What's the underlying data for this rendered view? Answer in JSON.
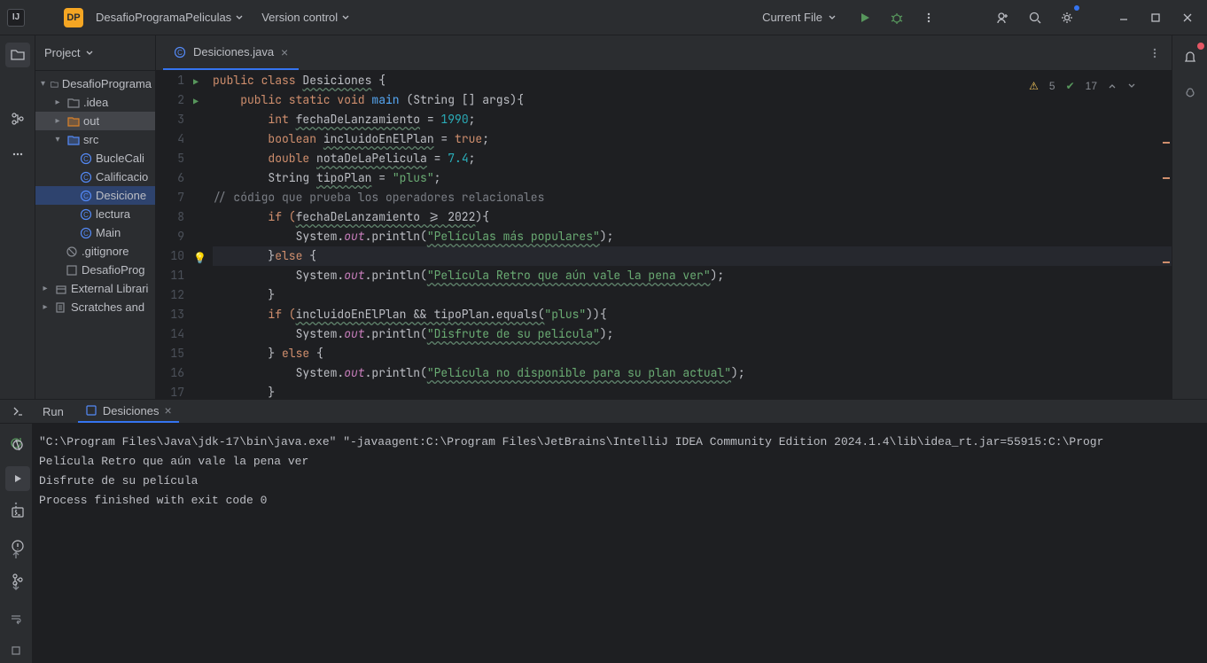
{
  "topbar": {
    "project_badge": "DP",
    "project_name": "DesafioProgramaPeliculas",
    "version_control": "Version control",
    "run_config": "Current File"
  },
  "project_panel": {
    "title": "Project",
    "tree": {
      "root": "DesafioPrograma",
      "idea": ".idea",
      "out": "out",
      "src": "src",
      "files": {
        "bucle": "BucleCali",
        "calif": "Calificacio",
        "desic": "Desicione",
        "lectura": "lectura",
        "main": "Main"
      },
      "gitignore": ".gitignore",
      "iml": "DesafioProg",
      "external": "External Librari",
      "scratches": "Scratches and"
    }
  },
  "editor": {
    "tab_name": "Desiciones.java",
    "warnings": "5",
    "checks": "17",
    "lines": [
      "1",
      "2",
      "3",
      "4",
      "5",
      "6",
      "7",
      "8",
      "9",
      "10",
      "11",
      "12",
      "13",
      "14",
      "15",
      "16",
      "17"
    ]
  },
  "code": {
    "l1": {
      "a": "public class ",
      "b": "Desiciones",
      "c": " {"
    },
    "l2": {
      "a": "    public static void ",
      "b": "main",
      "c": " (String [] args){"
    },
    "l3": {
      "a": "        int ",
      "b": "fechaDeLanzamiento",
      "c": " = ",
      "d": "1990",
      "e": ";"
    },
    "l4": {
      "a": "        boolean ",
      "b": "incluidoEnElPlan",
      "c": " = ",
      "d": "true",
      "e": ";"
    },
    "l5": {
      "a": "        double ",
      "b": "notaDeLaPelicula",
      "c": " = ",
      "d": "7.4",
      "e": ";"
    },
    "l6": {
      "a": "        String ",
      "b": "tipoPlan",
      "c": " = ",
      "d": "\"plus\"",
      "e": ";"
    },
    "l7": "// código que prueba los operadores relacionales",
    "l8": {
      "a": "        if (",
      "b": "fechaDeLanzamiento >= 2022",
      "c": "){"
    },
    "l9": {
      "a": "            System.",
      "b": "out",
      "c": ".println(",
      "d": "\"Películas más populares\"",
      "e": ");"
    },
    "l10": {
      "a": "        }",
      "b": "else ",
      "c": "{"
    },
    "l11": {
      "a": "            System.",
      "b": "out",
      "c": ".println(",
      "d": "\"Película Retro que aún vale la pena ver\"",
      "e": ");"
    },
    "l12": "        }",
    "l13": {
      "a": "        if (",
      "b": "incluidoEnElPlan && tipoPlan.equals(",
      "c": "\"plus\"",
      "d": ")",
      "e": "){"
    },
    "l14": {
      "a": "            System.",
      "b": "out",
      "c": ".println(",
      "d": "\"Disfrute de su película\"",
      "e": ");"
    },
    "l15": {
      "a": "        } ",
      "b": "else ",
      "c": "{"
    },
    "l16": {
      "a": "            System.",
      "b": "out",
      "c": ".println(",
      "d": "\"Película no disponible para su plan actual\"",
      "e": ");"
    },
    "l17": "        }"
  },
  "run": {
    "label": "Run",
    "subtab": "Desiciones",
    "output_line1": "\"C:\\Program Files\\Java\\jdk-17\\bin\\java.exe\" \"-javaagent:C:\\Program Files\\JetBrains\\IntelliJ IDEA Community Edition 2024.1.4\\lib\\idea_rt.jar=55915:C:\\Progr",
    "output_line2": "Película Retro que aún vale la pena ver",
    "output_line3": "Disfrute de su película",
    "output_line4": "",
    "output_line5": "Process finished with exit code 0"
  }
}
